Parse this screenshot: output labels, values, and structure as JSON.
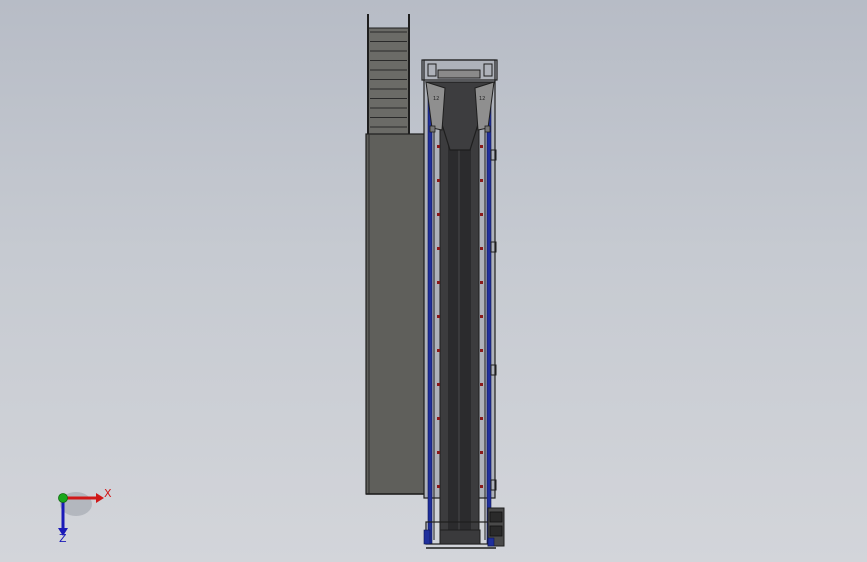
{
  "viewport": {
    "background_top": "#b7bcc6",
    "background_bottom": "#d3d5da"
  },
  "model": {
    "description_icon": "bucket-elevator-conveyor-top-view",
    "colors": {
      "outline": "#1e1e1e",
      "panel": "#5e5e5b",
      "panel_light": "#6d6d69",
      "belt": "#3a3a3c",
      "belt_center": "#2a2a2c",
      "rail": "#1f2f9c",
      "bolt": "#8a1a1a",
      "hopper": "#8f8f8f"
    }
  },
  "triad": {
    "x_label": "X",
    "z_label": "Z",
    "x_color": "#d01818",
    "y_color": "#1aa81a",
    "z_color": "#1a1ab8"
  }
}
